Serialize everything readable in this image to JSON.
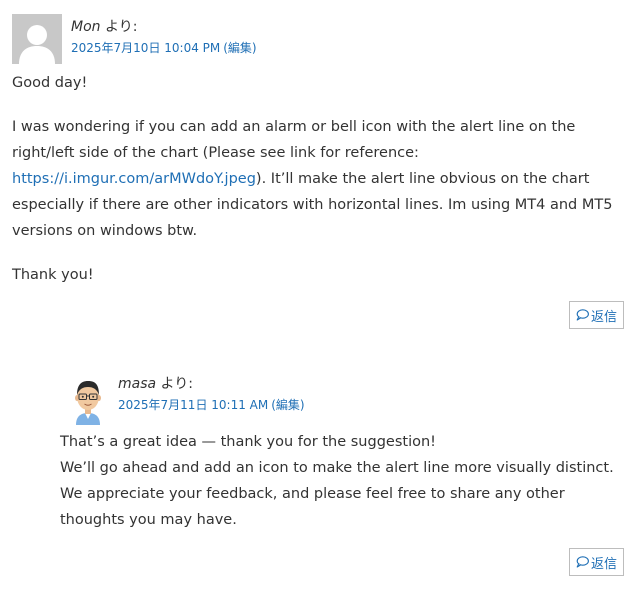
{
  "comments": [
    {
      "author": "Mon",
      "author_suffix": " より:",
      "date": "2025年7月10日 10:04 PM",
      "edit_label": "(編集)",
      "paragraphs": {
        "greeting": "Good day!",
        "body_part1": "I was wondering if you can add an alarm or bell icon with the alert line on the right/left side of the chart (Please see link for reference: ",
        "link_text": "https://i.imgur.com/arMWdoY.jpeg",
        "body_part2": "). It’ll make the alert line obvious on the chart especially if there are other indicators with horizontal lines. Im using MT4 and MT5 versions on windows btw.",
        "closing": "Thank you!"
      },
      "reply_label": "返信",
      "avatar_icon": "default-user-avatar"
    },
    {
      "author": "masa",
      "author_suffix": " より:",
      "date": "2025年7月11日 10:11 AM",
      "edit_label": "(編集)",
      "lines": [
        "That’s a great idea — thank you for the suggestion!",
        "We’ll go ahead and add an icon to make the alert line more visually distinct.",
        "We appreciate your feedback, and please feel free to share any other thoughts you may have."
      ],
      "reply_label": "返信",
      "avatar_icon": "man-with-glasses-avatar"
    }
  ],
  "colors": {
    "link": "#1f6fb5",
    "text": "#333333",
    "avatar_bg": "#c8c8c8"
  }
}
